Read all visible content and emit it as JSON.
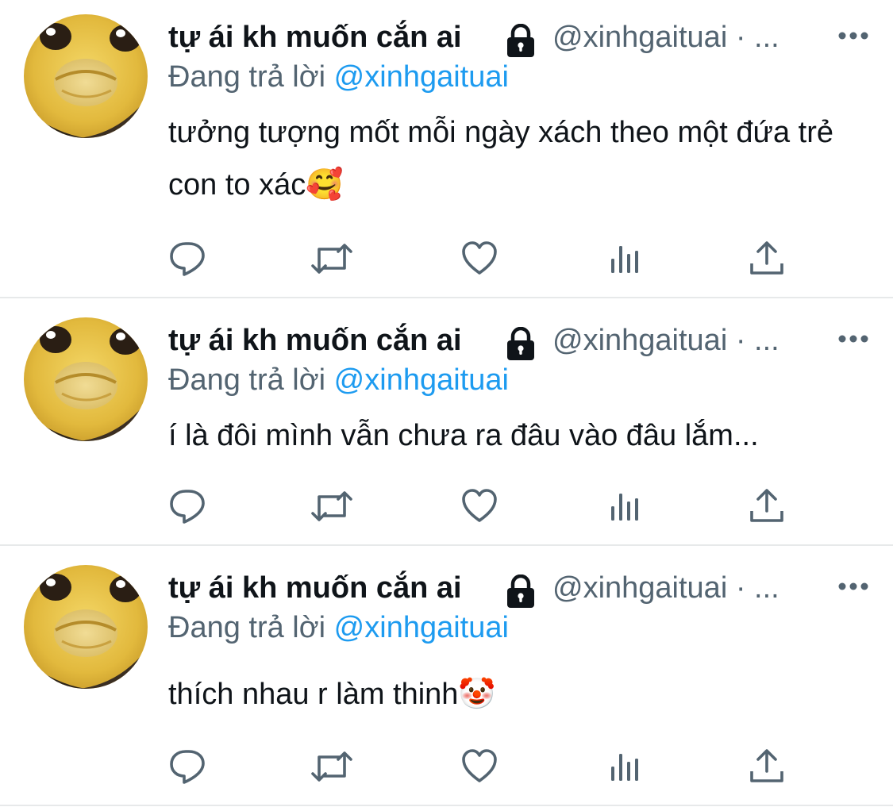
{
  "tweets": [
    {
      "display_name": "tự ái kh muốn cắn ai",
      "handle": "@xinhgaituai · ...",
      "reply_prefix": "Đang trả lời",
      "reply_to": "@xinhgaituai",
      "text": "tưởng tượng mốt mỗi ngày xách theo một đứa trẻ con to xác🥰"
    },
    {
      "display_name": "tự ái kh muốn cắn ai",
      "handle": "@xinhgaituai · ...",
      "reply_prefix": "Đang trả lời",
      "reply_to": "@xinhgaituai",
      "text": "í là đôi mình vẫn chưa ra đâu vào đâu lắm..."
    },
    {
      "display_name": "tự ái kh muốn cắn ai",
      "handle": "@xinhgaituai · ...",
      "reply_prefix": "Đang trả lời",
      "reply_to": "@xinhgaituai",
      "text": "thích nhau r làm thinh🤡"
    }
  ],
  "icons": {
    "lock": "lock-icon",
    "more": "more-icon",
    "reply": "reply-icon",
    "retweet": "retweet-icon",
    "like": "heart-icon",
    "views": "analytics-icon",
    "share": "share-icon"
  },
  "colors": {
    "text": "#0f1419",
    "secondary": "#536471",
    "link": "#1d9bf0",
    "divider": "#e7e9ea"
  }
}
